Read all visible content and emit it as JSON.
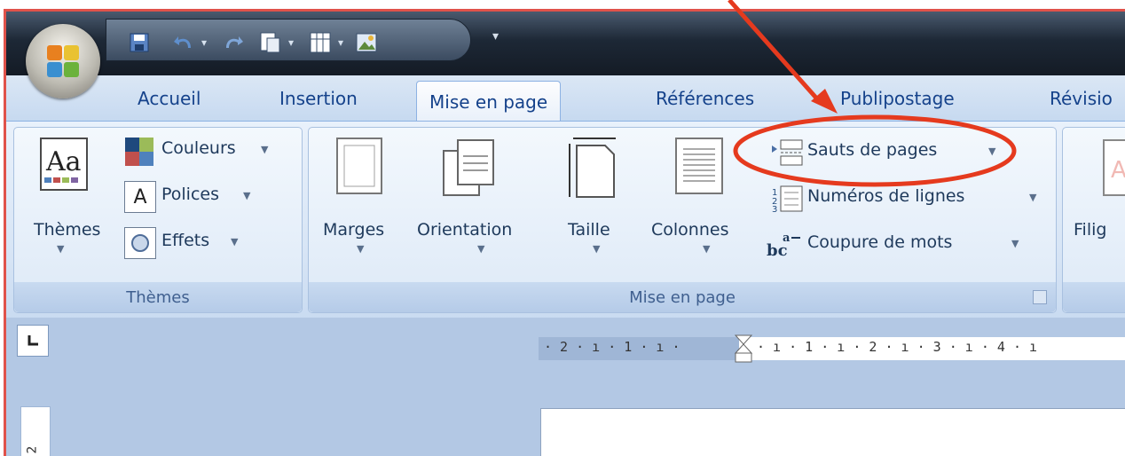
{
  "qat": {
    "customize": "▾"
  },
  "tabs": [
    "Accueil",
    "Insertion",
    "Mise en page",
    "Références",
    "Publipostage",
    "Révisio"
  ],
  "groups": {
    "themes": {
      "label": "Thèmes",
      "big_button": "Thèmes",
      "items": [
        "Couleurs",
        "Polices",
        "Effets"
      ]
    },
    "page_setup": {
      "label": "Mise en page",
      "big_buttons": [
        "Marges",
        "Orientation",
        "Taille",
        "Colonnes"
      ],
      "small_buttons": [
        "Sauts de pages",
        "Numéros de lignes",
        "Coupure de mots"
      ]
    },
    "page_background": {
      "big_button": "Filig"
    }
  },
  "ruler": {
    "left_text": "· 2 · ı · 1 · ı ·",
    "right_text": "· ı · 1 · ı · 2 · ı · 3 · ı · 4 · ı",
    "vertical_number": "2"
  },
  "colors": {
    "highlight": "#e53a1e",
    "tab_text": "#15428b"
  }
}
